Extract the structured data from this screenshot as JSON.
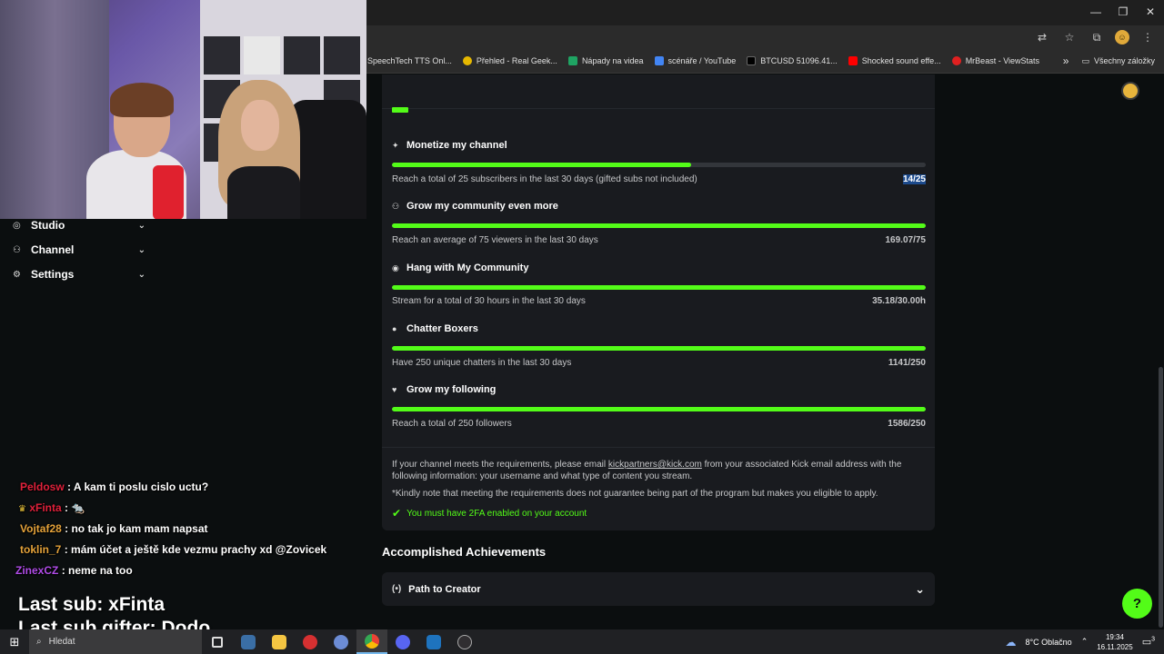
{
  "browser": {
    "window_controls": {
      "minimize": "—",
      "restore": "❐",
      "close": "✕"
    },
    "bookmarks": [
      {
        "label": "SpeechTech TTS Onl...",
        "color": "#3a7bd5"
      },
      {
        "label": "Přehled - Real Geek...",
        "color": "#e6b800"
      },
      {
        "label": "Nápady na videa",
        "color": "#1fa463"
      },
      {
        "label": "scénáře / YouTube",
        "color": "#4285f4"
      },
      {
        "label": "BTCUSD 51096.41...",
        "color": "#131722"
      },
      {
        "label": "Shocked sound effe...",
        "color": "#ff0000"
      },
      {
        "label": "MrBeast - ViewStats",
        "color": "#e02020"
      }
    ],
    "bookmarks_more": "»",
    "all_bookmarks": "Všechny záložky"
  },
  "sidebar": {
    "items": [
      {
        "label": "Studio",
        "icon": "studio-icon"
      },
      {
        "label": "Channel",
        "icon": "channel-icon"
      },
      {
        "label": "Settings",
        "icon": "gear-icon"
      }
    ]
  },
  "chat": [
    {
      "user": "Peldosw",
      "color": "#e0213b",
      "message": ": A kam ti poslu cislo uctu?"
    },
    {
      "user": "xFinta",
      "color": "#e0213b",
      "message": ":",
      "emote": "🐀",
      "badge": "♛"
    },
    {
      "user": "Vojtaf28",
      "color": "#e4a23a",
      "message": ": no tak jo kam mam napsat"
    },
    {
      "user": "toklin_7",
      "color": "#e4a23a",
      "message": ": mám účet a ještě kde vezmu prachy xd @Zovicek"
    },
    {
      "user": "ZinexCZ",
      "color": "#b04ce8",
      "message": ": neme na too"
    }
  ],
  "overlay": {
    "last_sub": "Last sub: xFinta",
    "last_sub_gifter": "Last sub gifter: Dodo"
  },
  "goals": [
    {
      "title": "Monetize my channel",
      "icon": "sparkle-icon",
      "desc": "Reach a total of 25 subscribers in the last 30 days (gifted subs not included)",
      "progress_text": "14/25",
      "fraction": 0.56
    },
    {
      "title": "Grow my community even more",
      "icon": "community-icon",
      "desc": "Reach an average of 75 viewers in the last 30 days",
      "progress_text": "169.07/75",
      "fraction": 1.0
    },
    {
      "title": "Hang with My Community",
      "icon": "broadcast-icon",
      "desc": "Stream for a total of 30 hours in the last 30 days",
      "progress_text": "35.18/30.00h",
      "fraction": 1.0
    },
    {
      "title": "Chatter Boxers",
      "icon": "chat-bubble-icon",
      "desc": "Have 250 unique chatters in the last 30 days",
      "progress_text": "1141/250",
      "fraction": 1.0
    },
    {
      "title": "Grow my following",
      "icon": "heart-icon",
      "desc": "Reach a total of 250 followers",
      "progress_text": "1586/250",
      "fraction": 1.0
    }
  ],
  "note": {
    "line1_pre": "If your channel meets the requirements, please email ",
    "email": "kickpartners@kick.com",
    "line1_post": " from your associated Kick email address with the following information: your username and what type of content you stream.",
    "line2": "*Kindly note that meeting the requirements does not guarantee being part of the program but makes you eligible to apply.",
    "twofa": "You must have 2FA enabled on your account"
  },
  "achievements": {
    "title": "Accomplished Achievements",
    "item": "Path to Creator"
  },
  "taskbar": {
    "search": "Hledat",
    "weather": "8°C  Oblačno",
    "time": "19:34",
    "date": "16.11.2025",
    "notifications": "3"
  },
  "colors": {
    "accent": "#53fc18",
    "card": "#191b1f",
    "background": "#0b0e0f"
  }
}
